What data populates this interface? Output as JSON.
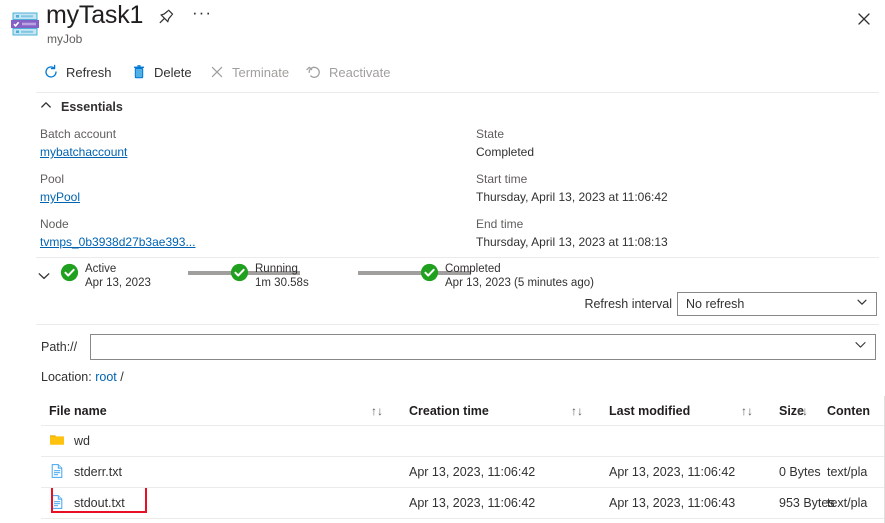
{
  "header": {
    "title": "myTask1",
    "subtitle": "myJob",
    "icon": "batch-task-icon",
    "pin_icon": "pin-icon",
    "more_icon": "ellipsis-icon",
    "close_icon": "close-icon"
  },
  "commandbar": {
    "items": [
      {
        "label": "Refresh",
        "icon": "refresh-icon",
        "disabled": false
      },
      {
        "label": "Delete",
        "icon": "trash-icon",
        "disabled": false
      },
      {
        "label": "Terminate",
        "icon": "cross-icon",
        "disabled": true
      },
      {
        "label": "Reactivate",
        "icon": "reactivate-icon",
        "disabled": true
      }
    ]
  },
  "essentials": {
    "section_label": "Essentials",
    "chevron": "chevron-up-icon",
    "left": [
      {
        "label": "Batch account",
        "value": "mybatchaccount",
        "link": true
      },
      {
        "label": "Pool",
        "value": "myPool",
        "link": true
      },
      {
        "label": "Node",
        "value": "tvmps_0b3938d27b3ae393...",
        "link": true
      }
    ],
    "right": [
      {
        "label": "State",
        "value": "Completed",
        "link": false
      },
      {
        "label": "Start time",
        "value": "Thursday, April 13, 2023 at 11:06:42",
        "link": false
      },
      {
        "label": "End time",
        "value": "Thursday, April 13, 2023 at 11:08:13",
        "link": false
      }
    ]
  },
  "timeline": {
    "chevron": "chevron-down-icon",
    "steps": [
      {
        "name": "Active",
        "meta": "Apr 13, 2023",
        "status": "complete"
      },
      {
        "name": "Running",
        "meta": "1m 30.58s",
        "status": "complete"
      },
      {
        "name": "Completed",
        "meta": "Apr 13, 2023 (5 minutes ago)",
        "status": "complete"
      }
    ]
  },
  "refresh_interval": {
    "label": "Refresh interval",
    "value": "No refresh",
    "chevron": "chevron-down-icon",
    "options": [
      "No refresh"
    ]
  },
  "path": {
    "label": "Path://",
    "value": "",
    "placeholder": "",
    "chevron": "chevron-down-icon"
  },
  "location": {
    "prefix": "Location:",
    "link": "root",
    "suffix": "/"
  },
  "file_table": {
    "columns": [
      {
        "key": "name",
        "label": "File name",
        "sortable": true
      },
      {
        "key": "ctime",
        "label": "Creation time",
        "sortable": true
      },
      {
        "key": "lmod",
        "label": "Last modified",
        "sortable": true
      },
      {
        "key": "size",
        "label": "Size",
        "sortable": true
      },
      {
        "key": "ctype",
        "label": "Conten",
        "sortable": false
      }
    ],
    "sort_icon": "↑↓",
    "rows": [
      {
        "name": "wd",
        "icon": "folder-icon",
        "ctime": "",
        "lmod": "",
        "size": "",
        "ctype": "",
        "highlighted": false
      },
      {
        "name": "stderr.txt",
        "icon": "file-text-icon",
        "ctime": "Apr 13, 2023, 11:06:42",
        "lmod": "Apr 13, 2023, 11:06:42",
        "size": "0 Bytes",
        "ctype": "text/pla",
        "highlighted": false
      },
      {
        "name": "stdout.txt",
        "icon": "file-text-icon",
        "ctime": "Apr 13, 2023, 11:06:42",
        "lmod": "Apr 13, 2023, 11:06:43",
        "size": "953 Bytes",
        "ctype": "text/pla",
        "highlighted": true
      }
    ]
  },
  "colors": {
    "accent": "#0078d4",
    "link": "#0063b1",
    "success": "#107c10",
    "success_bright": "#1fa01f",
    "disabled": "#a19f9d",
    "annotation": "#e81123",
    "folder": "#ffb900",
    "border": "#edebe9"
  }
}
